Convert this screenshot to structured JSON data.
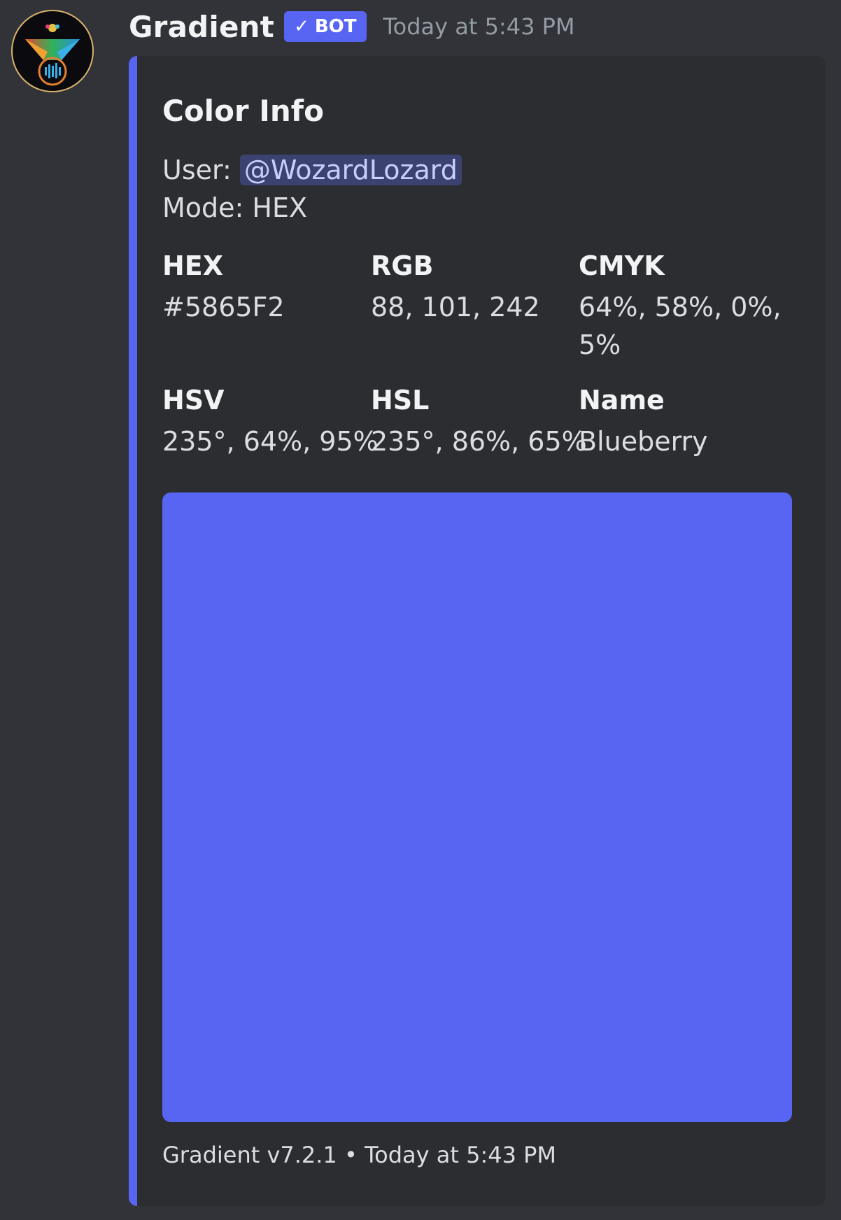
{
  "message": {
    "author": "Gradient",
    "bot_tag": "BOT",
    "timestamp": "Today at 5:43 PM"
  },
  "embed": {
    "accent_color": "#5865f2",
    "title": "Color Info",
    "user_label": "User:",
    "user_mention": "@WozardLozard",
    "mode_line": "Mode: HEX",
    "fields": [
      {
        "name": "HEX",
        "value": "#5865F2"
      },
      {
        "name": "RGB",
        "value": "88, 101, 242"
      },
      {
        "name": "CMYK",
        "value": "64%, 58%, 0%, 5%"
      },
      {
        "name": "HSV",
        "value": "235°, 64%, 95%"
      },
      {
        "name": "HSL",
        "value": "235°, 86%, 65%"
      },
      {
        "name": "Name",
        "value": "Blueberry"
      }
    ],
    "swatch_color": "#5865f2",
    "footer": "Gradient v7.2.1 • Today at 5:43 PM"
  },
  "icons": {
    "avatar": "gradient-logo-icon",
    "bot_check": "checkmark-icon"
  }
}
